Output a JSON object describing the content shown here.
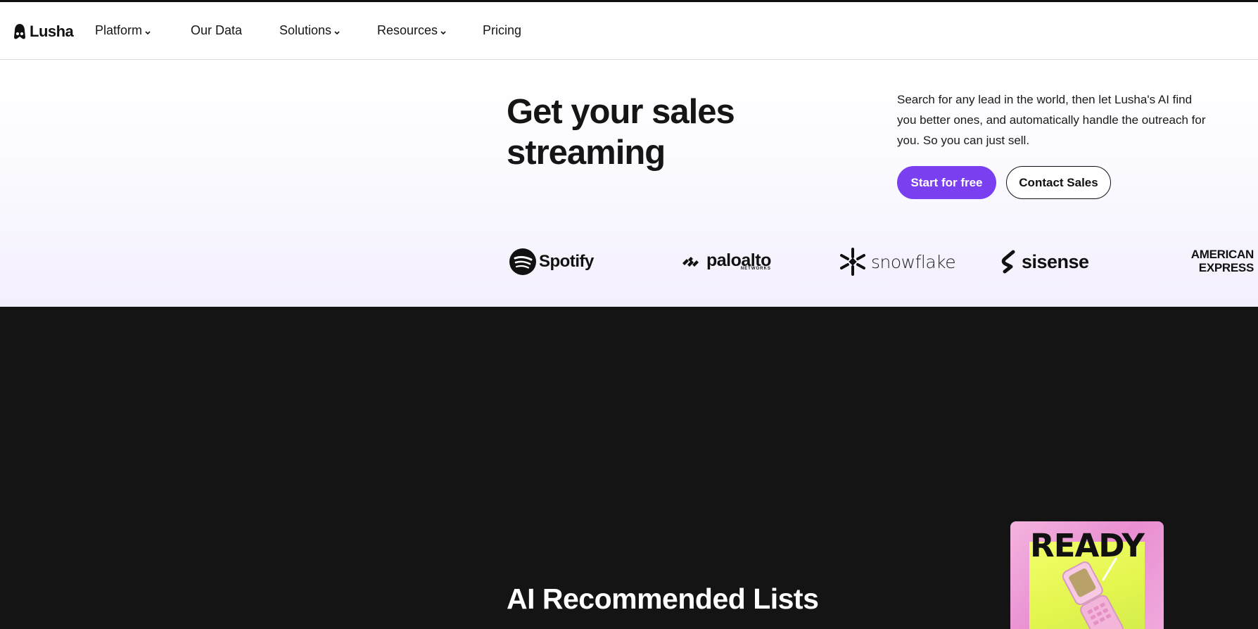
{
  "brand": {
    "name": "Lusha",
    "accent": "#7b3ff2"
  },
  "nav": {
    "items": [
      {
        "label": "Platform",
        "has_dropdown": true
      },
      {
        "label": "Our Data",
        "has_dropdown": false
      },
      {
        "label": "Solutions",
        "has_dropdown": true
      },
      {
        "label": "Resources",
        "has_dropdown": true
      },
      {
        "label": "Pricing",
        "has_dropdown": false
      }
    ]
  },
  "hero": {
    "title": "Get your sales streaming",
    "description": "Search for any lead in the world, then let Lusha's AI find you better ones, and automatically handle the outreach for you. So you can just sell.",
    "primary_cta": "Start for free",
    "secondary_cta": "Contact Sales"
  },
  "customer_logos": {
    "spotify": "Spotify",
    "paloalto": "paloalto",
    "paloalto_sub": "NETWORKS",
    "snowflake": "snowflake",
    "sisense": "sisense",
    "amex_line1": "AMERICAN",
    "amex_line2": "EXPRESS"
  },
  "section": {
    "title": "AI Recommended Lists",
    "card_word": "READY"
  },
  "colors": {
    "dark_section": "#141414",
    "card_pink": "#e98fd1",
    "card_yellow": "#e3f54e"
  }
}
